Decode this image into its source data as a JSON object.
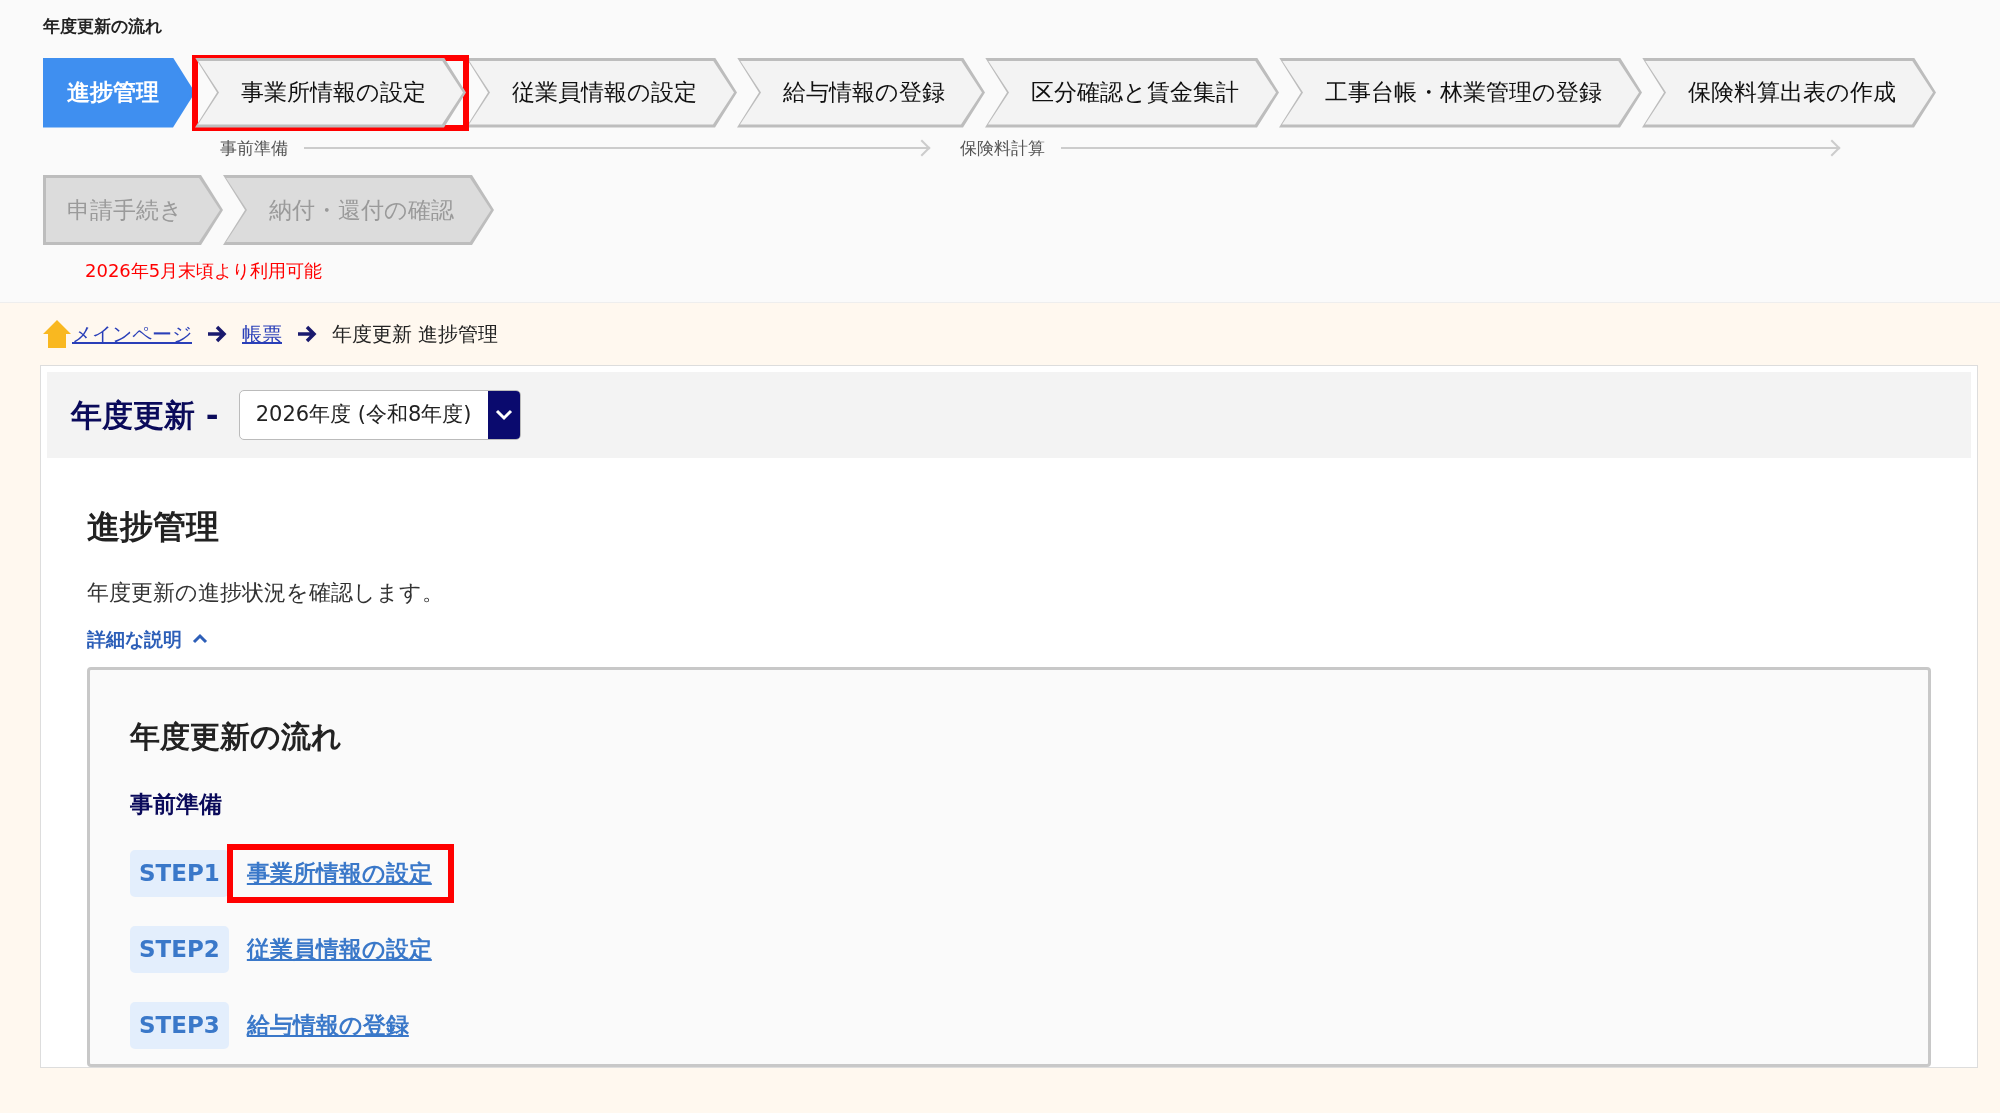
{
  "flow_title": "年度更新の流れ",
  "flow_steps": [
    {
      "label": "進捗管理",
      "selected": true,
      "highlighted": false
    },
    {
      "label": "事業所情報の設定",
      "selected": false,
      "highlighted": true
    },
    {
      "label": "従業員情報の設定",
      "selected": false,
      "highlighted": false
    },
    {
      "label": "給与情報の登録",
      "selected": false,
      "highlighted": false
    },
    {
      "label": "区分確認と賃金集計",
      "selected": false,
      "highlighted": false
    },
    {
      "label": "工事台帳・林業管理の登録",
      "selected": false,
      "highlighted": false
    },
    {
      "label": "保険料算出表の作成",
      "selected": false,
      "highlighted": false
    }
  ],
  "phases": [
    {
      "label": "事前準備"
    },
    {
      "label": "保険料計算"
    }
  ],
  "later_steps": [
    {
      "label": "申請手続き",
      "disabled": true,
      "highlighted": false
    },
    {
      "label": "納付・還付の確認",
      "disabled": true,
      "highlighted": false
    }
  ],
  "availability_note": "2026年5月末頃より利用可能",
  "breadcrumb": [
    {
      "label": "メインページ",
      "kind": "home"
    },
    {
      "label": "帳票",
      "kind": "link"
    },
    {
      "label": "年度更新 進捗管理",
      "kind": "current"
    }
  ],
  "page_header": {
    "title": "年度更新 -",
    "year_select": "2026年度 (令和8年度)"
  },
  "section": {
    "title": "進捗管理",
    "description": "年度更新の進捗状況を確認します。",
    "details_toggle": {
      "label": "詳細な説明",
      "expanded": true
    }
  },
  "flow_box": {
    "title": "年度更新の流れ",
    "groups": [
      {
        "title": "事前準備",
        "steps": [
          {
            "badge": "STEP1",
            "label": "事業所情報の設定",
            "highlighted": true
          },
          {
            "badge": "STEP2",
            "label": "従業員情報の設定",
            "highlighted": false
          },
          {
            "badge": "STEP3",
            "label": "給与情報の登録",
            "highlighted": false
          }
        ]
      }
    ]
  }
}
